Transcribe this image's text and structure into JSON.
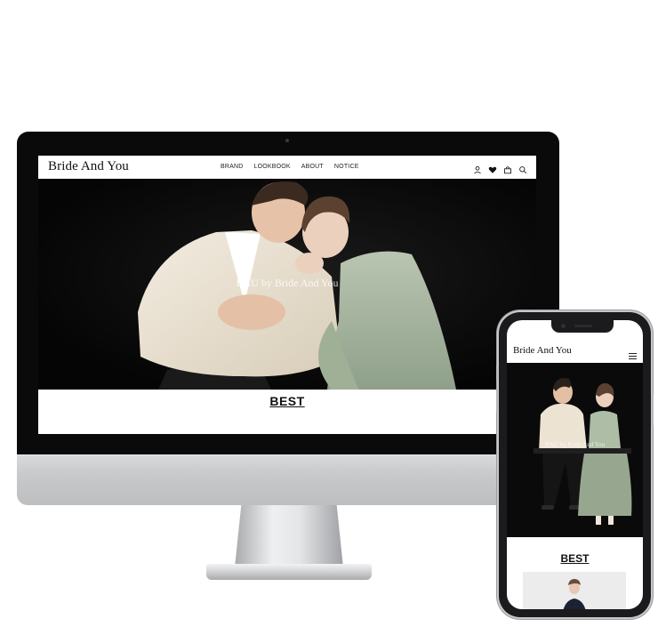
{
  "desktop": {
    "brand_logo": "Bride And You",
    "nav": [
      {
        "label": "BRAND"
      },
      {
        "label": "LOOKBOOK"
      },
      {
        "label": "ABOUT"
      },
      {
        "label": "NOTICE"
      }
    ],
    "icons": [
      "user-icon",
      "heart-icon",
      "cart-icon",
      "search-icon"
    ],
    "hero_caption": "BAU by Bride And You",
    "section_title": "BEST"
  },
  "mobile": {
    "brand_logo": "Bride And You",
    "menu_icon": "hamburger-menu-icon",
    "hero_caption": "BAU by Bride And You",
    "section_title": "BEST"
  },
  "colors": {
    "hero_background": "#0b0b0b",
    "jacket_cream": "#ece3d3",
    "dress_sage": "#a7b6a0",
    "device_silver": "#c8c9cb"
  }
}
